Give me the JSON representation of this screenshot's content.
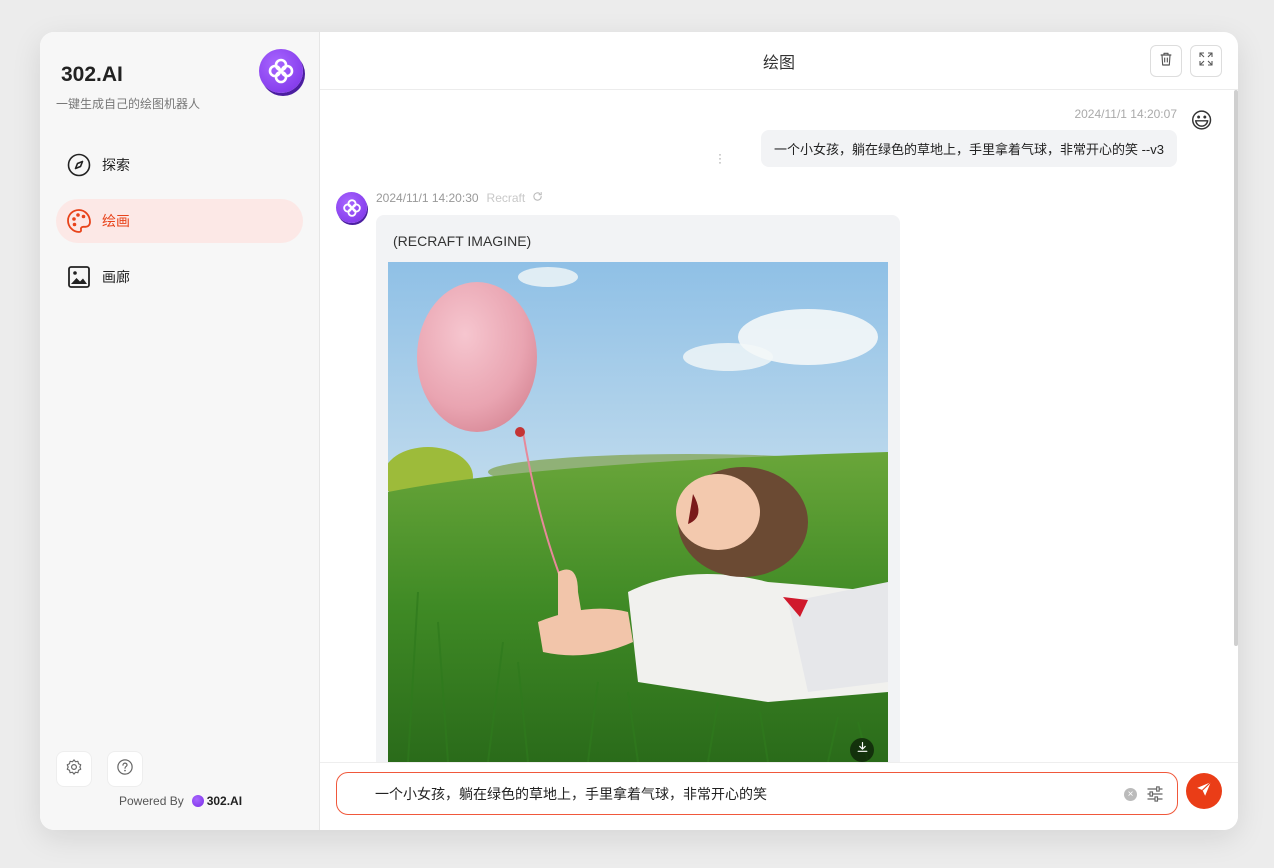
{
  "sidebar": {
    "brand_name": "302.AI",
    "tagline": "一键生成自己的绘图机器人",
    "items": [
      {
        "label": "探索",
        "icon": "compass-icon",
        "active": false
      },
      {
        "label": "绘画",
        "icon": "palette-icon",
        "active": true
      },
      {
        "label": "画廊",
        "icon": "image-icon",
        "active": false
      }
    ],
    "powered_by": "Powered By",
    "powered_brand": "302.AI"
  },
  "header": {
    "title": "绘图"
  },
  "chat": {
    "user_message": {
      "timestamp": "2024/11/1 14:20:07",
      "text": "一个小女孩，躺在绿色的草地上，手里拿着气球，非常开心的笑 --v3",
      "avatar_emoji": "😃"
    },
    "bot_message": {
      "timestamp": "2024/11/1 14:20:30",
      "model": "Recraft",
      "title": "(RECRAFT IMAGINE)"
    }
  },
  "input": {
    "value": "一个小女孩，躺在绿色的草地上，手里拿着气球，非常开心的笑"
  },
  "colors": {
    "accent": "#ea3d17",
    "active_bg": "#fce8e6",
    "brand_purple": "#8b3ff0"
  }
}
